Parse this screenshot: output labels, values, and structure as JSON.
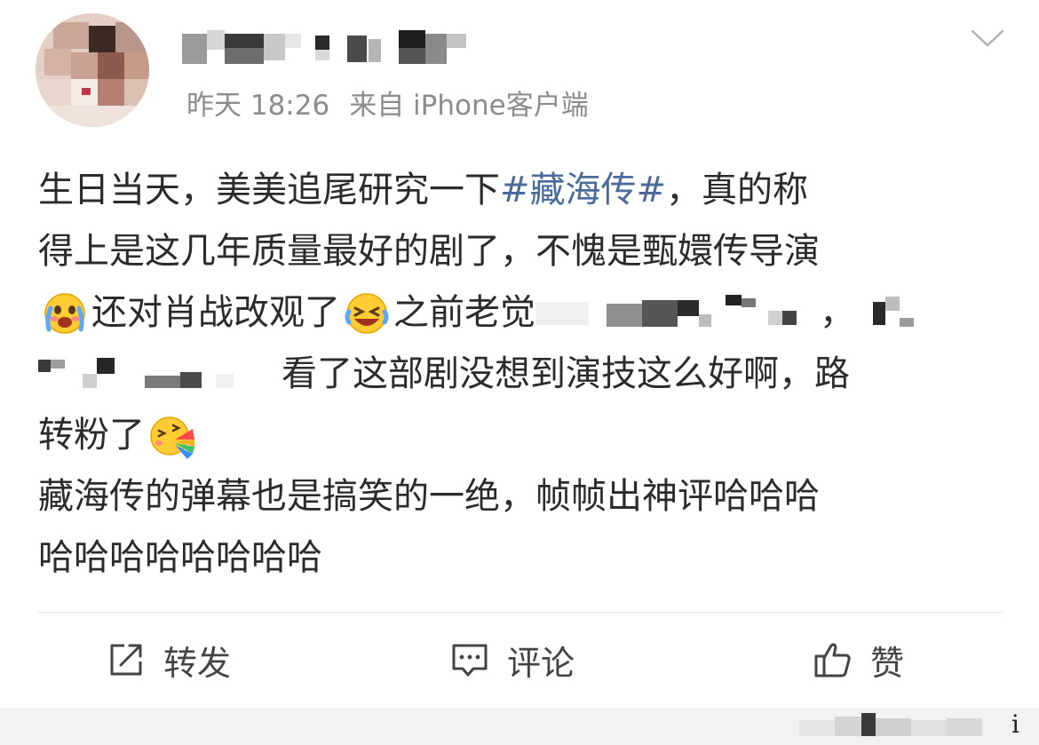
{
  "post": {
    "time": "昨天 18:26",
    "source": "来自 iPhone客户端",
    "lines": [
      {
        "a": "生日当天，美美追尾研究一下",
        "hashtag": "#藏海传#",
        "b": "，真的称"
      },
      {
        "a": "得上是这几年质量最好的剧了，不愧是甄嬛传导演"
      },
      {
        "a": "还对肖战改观了",
        "b": "之前老觉",
        "c": "，"
      },
      {
        "a": "看了这部剧没想到演技这么好啊，路"
      },
      {
        "a": "转粉了"
      },
      {
        "a": "藏海传的弹幕也是搞笑的一绝，帧帧出神评哈哈哈"
      },
      {
        "a": "哈哈哈哈哈哈哈哈"
      }
    ],
    "emojis": [
      "crying-face-emoji",
      "laughing-tears-emoji",
      "rainbow-vomit-emoji"
    ]
  },
  "actions": {
    "repost": "转发",
    "comment": "评论",
    "like": "赞"
  },
  "colors": {
    "text": "#2b2b2b",
    "meta": "#8c8c8c",
    "hashtag": "#4a6a9b",
    "divider": "#e6e6e6"
  },
  "bottom": {
    "glyph": "i"
  }
}
